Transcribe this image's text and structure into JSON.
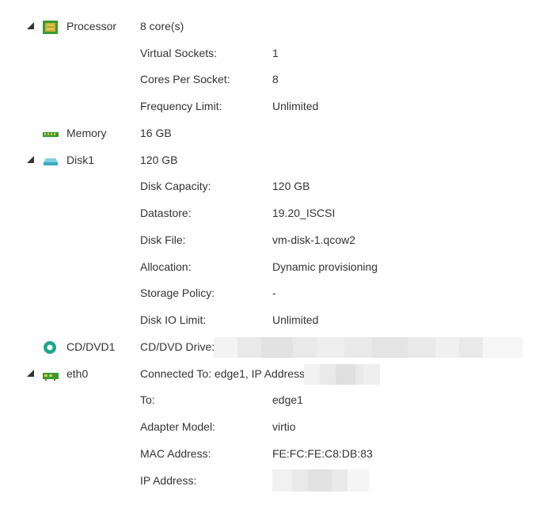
{
  "hardware": {
    "processor": {
      "name": "Processor",
      "icon": "processor-icon",
      "summary": "8 core(s)",
      "virtual_sockets_label": "Virtual Sockets:",
      "virtual_sockets_value": "1",
      "cores_per_socket_label": "Cores Per Socket:",
      "cores_per_socket_value": "8",
      "frequency_limit_label": "Frequency Limit:",
      "frequency_limit_value": "Unlimited"
    },
    "memory": {
      "name": "Memory",
      "icon": "memory-icon",
      "summary": "16 GB"
    },
    "disk1": {
      "name": "Disk1",
      "icon": "disk-icon",
      "summary": "120 GB",
      "disk_capacity_label": "Disk Capacity:",
      "disk_capacity_value": "120 GB",
      "datastore_label": "Datastore:",
      "datastore_value": "19.20_ISCSI",
      "disk_file_label": "Disk File:",
      "disk_file_value": "vm-disk-1.qcow2",
      "allocation_label": "Allocation:",
      "allocation_value": "Dynamic provisioning",
      "storage_policy_label": "Storage Policy:",
      "storage_policy_value": "-",
      "disk_io_limit_label": "Disk IO Limit:",
      "disk_io_limit_value": "Unlimited"
    },
    "cddvd1": {
      "name": "CD/DVD1",
      "icon": "disc-icon",
      "drive_label": "CD/DVD Drive:"
    },
    "eth0": {
      "name": "eth0",
      "icon": "network-adapter-icon",
      "summary_label": "Connected To: edge1, IP Address:",
      "to_label": "To:",
      "to_value": "edge1",
      "adapter_model_label": "Adapter Model:",
      "adapter_model_value": "virtio",
      "mac_address_label": "MAC Address:",
      "mac_address_value": "FE:FC:FE:C8:DB:83",
      "ip_address_label": "IP Address:"
    }
  },
  "colors": {
    "text": "#333333",
    "processor_icon": "#3a9a2e",
    "memory_icon": "#3a9a2e",
    "disk_icon": "#3aa9c4",
    "disc_icon": "#1aa88a",
    "network_icon": "#3a9a2e"
  }
}
